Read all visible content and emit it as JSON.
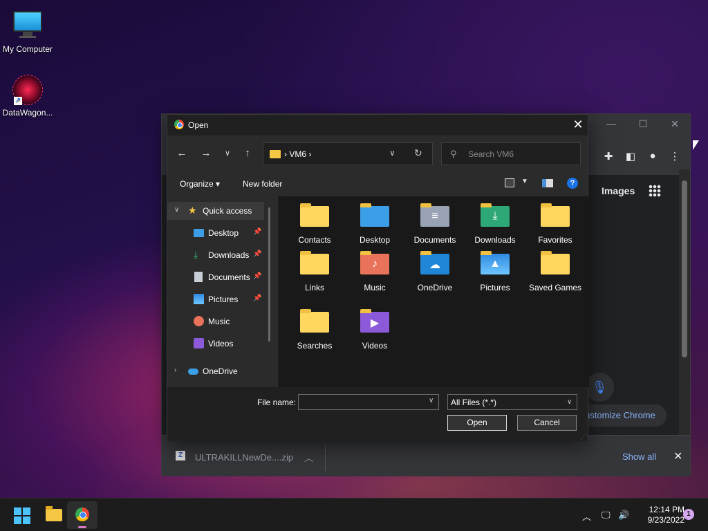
{
  "desktop": {
    "icons": [
      {
        "label": "My Computer"
      },
      {
        "label": "DataWagon..."
      }
    ]
  },
  "browser": {
    "images_link": "Images",
    "customize_label": "ustomize Chrome",
    "download": {
      "file": "ULTRAKILLNewDe....zip",
      "show_all": "Show all"
    }
  },
  "dialog": {
    "title": "Open",
    "address": "VM6",
    "search_placeholder": "Search VM6",
    "organize": "Organize",
    "new_folder": "New folder",
    "help": "?",
    "nav": [
      {
        "label": "Quick access"
      },
      {
        "label": "Desktop"
      },
      {
        "label": "Downloads"
      },
      {
        "label": "Documents"
      },
      {
        "label": "Pictures"
      },
      {
        "label": "Music"
      },
      {
        "label": "Videos"
      },
      {
        "label": "OneDrive"
      }
    ],
    "files": [
      {
        "name": "Contacts"
      },
      {
        "name": "Desktop"
      },
      {
        "name": "Documents"
      },
      {
        "name": "Downloads"
      },
      {
        "name": "Favorites"
      },
      {
        "name": "Links"
      },
      {
        "name": "Music"
      },
      {
        "name": "OneDrive"
      },
      {
        "name": "Pictures"
      },
      {
        "name": "Saved Games"
      },
      {
        "name": "Searches"
      },
      {
        "name": "Videos"
      }
    ],
    "file_name_label": "File name:",
    "file_name_value": "",
    "file_type": "All Files (*.*)",
    "open_button": "Open",
    "cancel_button": "Cancel"
  },
  "taskbar": {
    "time": "12:14 PM",
    "date": "9/23/2022",
    "notifications": "1"
  },
  "colors": {
    "accent": "#1a73e8",
    "folder": "#ffd75e",
    "link": "#8ab4f8"
  }
}
